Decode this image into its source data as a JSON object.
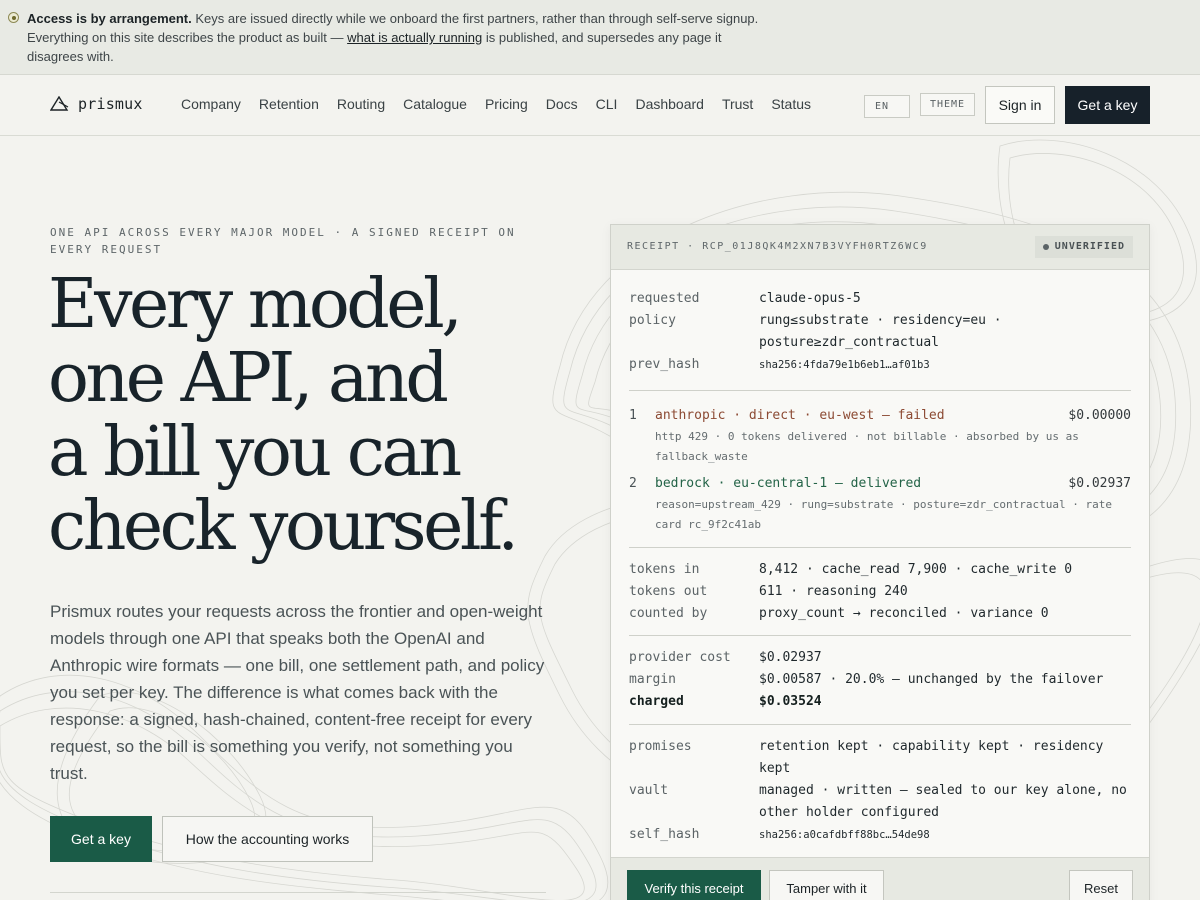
{
  "banner": {
    "bold": "Access is by arrangement.",
    "text_1": "Keys are issued directly while we onboard the first partners, rather than through self-serve signup. Everything on this site describes the product as built —",
    "link": "what is actually running",
    "text_2": "is published, and supersedes any page it disagrees with."
  },
  "header": {
    "logo": "prismux",
    "nav": [
      "Company",
      "Retention",
      "Routing",
      "Catalogue",
      "Pricing",
      "Docs",
      "CLI",
      "Dashboard",
      "Trust",
      "Status"
    ],
    "lang": "EN",
    "theme": "THEME",
    "signin": "Sign in",
    "get_key": "Get a key"
  },
  "hero": {
    "eyebrow": "ONE API ACROSS EVERY MAJOR MODEL · A SIGNED RECEIPT ON EVERY REQUEST",
    "title_lines": [
      "Every model,",
      "one API, and",
      "a bill you can",
      "check yourself."
    ],
    "body": "Prismux routes your requests across the frontier and open-weight models through one API that speaks both the OpenAI and Anthropic wire formats — one bill, one settlement path, and policy you set per key. The difference is what comes back with the response: a signed, hash-chained, content-free receipt for every request, so the bill is something you verify, not something you trust.",
    "cta_primary": "Get a key",
    "cta_secondary": "How the accounting works"
  },
  "receipt": {
    "id": "RECEIPT · RCP_01J8QK4M2XN7B3VYFH0RTZ6WC9",
    "status": "UNVERIFIED",
    "meta": [
      {
        "k": "requested",
        "v": "claude-opus-5"
      },
      {
        "k": "policy",
        "v": "rung≤substrate · residency=eu · posture≥zdr_contractual"
      },
      {
        "k": "prev_hash",
        "v": "sha256:4fda79e1b6eb1…af01b3",
        "small": true
      }
    ],
    "attempts": [
      {
        "n": "1",
        "route": "anthropic · direct · eu-west — failed",
        "amount": "$0.00000",
        "detail": "http 429 · 0 tokens delivered · not billable · absorbed by us as fallback_waste",
        "status": "failed"
      },
      {
        "n": "2",
        "route": "bedrock · eu-central-1 — delivered",
        "amount": "$0.02937",
        "detail": "reason=upstream_429 · rung=substrate · posture=zdr_contractual · rate card rc_9f2c41ab",
        "status": "delivered"
      }
    ],
    "tokens": [
      {
        "k": "tokens in",
        "v": "8,412 · cache_read 7,900 · cache_write 0"
      },
      {
        "k": "tokens out",
        "v": "611 · reasoning 240"
      },
      {
        "k": "counted by",
        "v": "proxy_count → reconciled · variance 0"
      }
    ],
    "costs": [
      {
        "k": "provider cost",
        "v": "$0.02937"
      },
      {
        "k": "margin",
        "v": "$0.00587 · 20.0% — unchanged by the failover"
      },
      {
        "k": "charged",
        "v": "$0.03524",
        "bold": true
      }
    ],
    "promises": [
      {
        "k": "promises",
        "v": "retention kept · capability kept · residency kept"
      },
      {
        "k": "vault",
        "v": "managed · written — sealed to our key alone, no other holder configured"
      },
      {
        "k": "self_hash",
        "v": "sha256:a0cafdbff88bc…54de98",
        "small": true
      }
    ],
    "actions": {
      "verify": "Verify this receipt",
      "tamper": "Tamper with it",
      "reset": "Reset"
    }
  },
  "colors": {
    "accent_green": "#1a5b47",
    "dark_button": "#17212a",
    "failed": "#8c4a33",
    "delivered": "#236347"
  }
}
